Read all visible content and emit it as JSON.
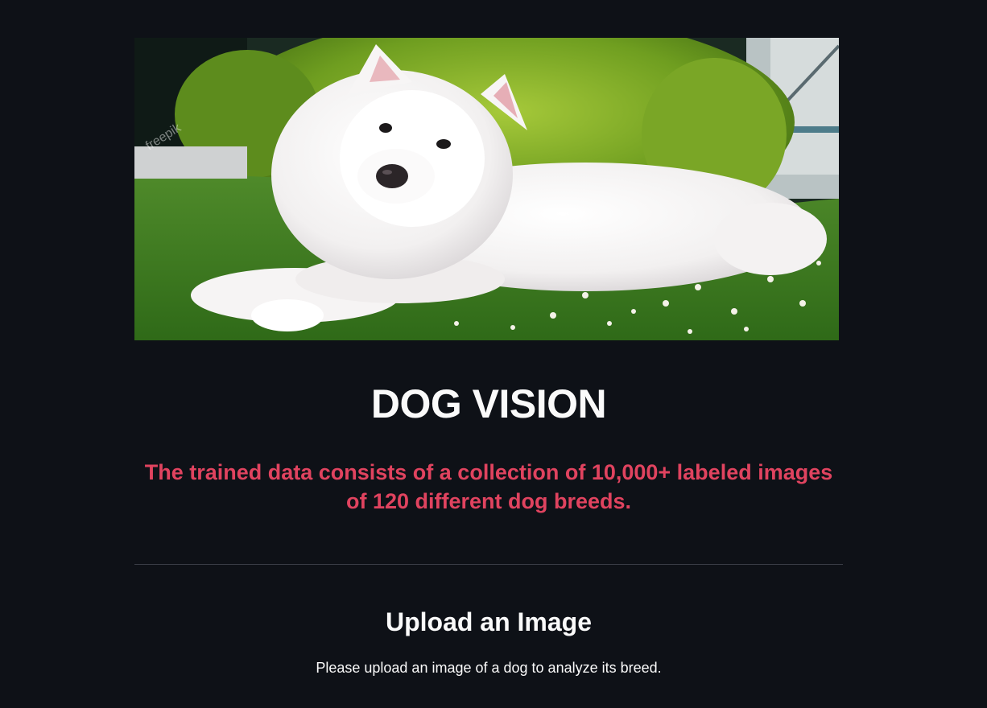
{
  "hero": {
    "alt": "Fluffy white dog lying on grass",
    "watermark": "freepik"
  },
  "title": "DOG VISION",
  "subtitle": "The trained data consists of a collection of 10,000+ labeled images of 120 different dog breeds.",
  "upload": {
    "heading": "Upload an Image",
    "instructions": "Please upload an image of a dog to analyze its breed."
  },
  "colors": {
    "background": "#0e1117",
    "subtitle": "#e0435f",
    "text": "#fafafa"
  }
}
